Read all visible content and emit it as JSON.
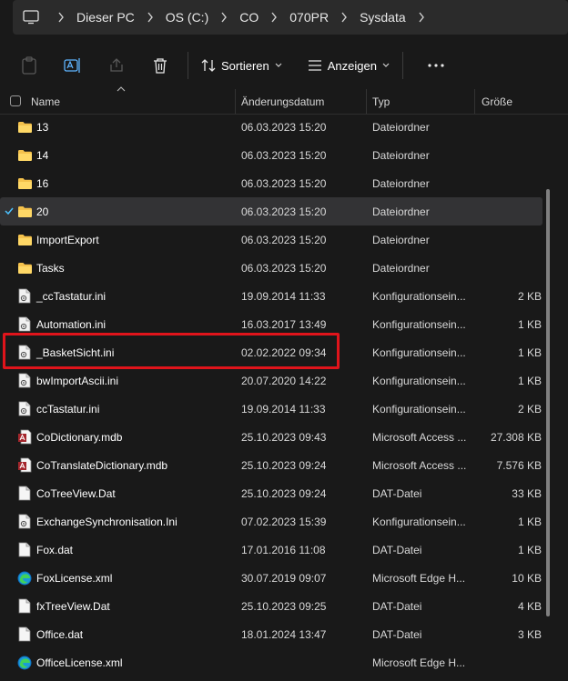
{
  "breadcrumb": [
    "Dieser PC",
    "OS (C:)",
    "CO",
    "070PR",
    "Sysdata"
  ],
  "toolbar": {
    "sort_label": "Sortieren",
    "view_label": "Anzeigen"
  },
  "columns": {
    "name": "Name",
    "date": "Änderungsdatum",
    "type": "Typ",
    "size": "Größe"
  },
  "files": [
    {
      "name": "13",
      "date": "06.03.2023 15:20",
      "type": "Dateiordner",
      "size": "",
      "icon": "folder-icon"
    },
    {
      "name": "14",
      "date": "06.03.2023 15:20",
      "type": "Dateiordner",
      "size": "",
      "icon": "folder-icon"
    },
    {
      "name": "16",
      "date": "06.03.2023 15:20",
      "type": "Dateiordner",
      "size": "",
      "icon": "folder-icon"
    },
    {
      "name": "20",
      "date": "06.03.2023 15:20",
      "type": "Dateiordner",
      "size": "",
      "icon": "folder-icon",
      "selected": true
    },
    {
      "name": "ImportExport",
      "date": "06.03.2023 15:20",
      "type": "Dateiordner",
      "size": "",
      "icon": "folder-icon"
    },
    {
      "name": "Tasks",
      "date": "06.03.2023 15:20",
      "type": "Dateiordner",
      "size": "",
      "icon": "folder-icon"
    },
    {
      "name": "_ccTastatur.ini",
      "date": "19.09.2014 11:33",
      "type": "Konfigurationsein...",
      "size": "2 KB",
      "icon": "config-file-icon"
    },
    {
      "name": "Automation.ini",
      "date": "16.03.2017 13:49",
      "type": "Konfigurationsein...",
      "size": "1 KB",
      "icon": "config-file-icon"
    },
    {
      "name": "_BasketSicht.ini",
      "date": "02.02.2022 09:34",
      "type": "Konfigurationsein...",
      "size": "1 KB",
      "icon": "config-file-icon"
    },
    {
      "name": "bwImportAscii.ini",
      "date": "20.07.2020 14:22",
      "type": "Konfigurationsein...",
      "size": "1 KB",
      "icon": "config-file-icon"
    },
    {
      "name": "ccTastatur.ini",
      "date": "19.09.2014 11:33",
      "type": "Konfigurationsein...",
      "size": "2 KB",
      "icon": "config-file-icon"
    },
    {
      "name": "CoDictionary.mdb",
      "date": "25.10.2023 09:43",
      "type": "Microsoft Access ...",
      "size": "27.308 KB",
      "icon": "access-db-icon"
    },
    {
      "name": "CoTranslateDictionary.mdb",
      "date": "25.10.2023 09:24",
      "type": "Microsoft Access ...",
      "size": "7.576 KB",
      "icon": "access-db-icon"
    },
    {
      "name": "CoTreeView.Dat",
      "date": "25.10.2023 09:24",
      "type": "DAT-Datei",
      "size": "33 KB",
      "icon": "file-icon"
    },
    {
      "name": "ExchangeSynchronisation.Ini",
      "date": "07.02.2023 15:39",
      "type": "Konfigurationsein...",
      "size": "1 KB",
      "icon": "config-file-icon"
    },
    {
      "name": "Fox.dat",
      "date": "17.01.2016 11:08",
      "type": "DAT-Datei",
      "size": "1 KB",
      "icon": "file-icon"
    },
    {
      "name": "FoxLicense.xml",
      "date": "30.07.2019 09:07",
      "type": "Microsoft Edge H...",
      "size": "10 KB",
      "icon": "edge-icon"
    },
    {
      "name": "fxTreeView.Dat",
      "date": "25.10.2023 09:25",
      "type": "DAT-Datei",
      "size": "4 KB",
      "icon": "file-icon"
    },
    {
      "name": "Office.dat",
      "date": "18.01.2024 13:47",
      "type": "DAT-Datei",
      "size": "3 KB",
      "icon": "file-icon"
    },
    {
      "name": "OfficeLicense.xml",
      "date": "",
      "type": "Microsoft Edge H...",
      "size": "",
      "icon": "edge-icon"
    }
  ],
  "colors": {
    "background": "#191919",
    "selected_row": "#333335",
    "highlight": "#e0141b",
    "folder": "#f5c24c",
    "accent": "#4cc2ff"
  }
}
